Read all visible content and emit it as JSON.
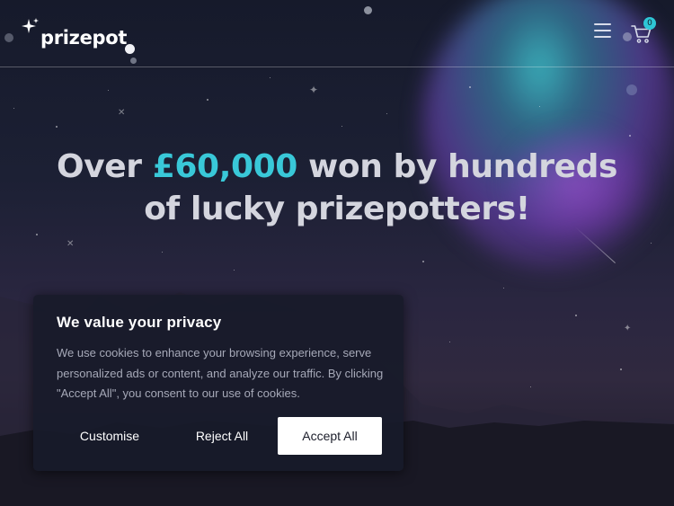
{
  "header": {
    "logo_text": "prizepot",
    "cart_count": "0",
    "menu_icon": "hamburger-menu-icon",
    "cart_icon": "shopping-cart-icon"
  },
  "hero": {
    "line1_before": "Over ",
    "line1_accent": "£60,000",
    "line1_after": " won by hundreds",
    "line2": "of lucky prizepotters!"
  },
  "cookie_banner": {
    "title": "We value your privacy",
    "body": "We use cookies to enhance your browsing experience, serve personalized ads or content, and analyze our traffic. By clicking \"Accept All\", you consent to our use of cookies.",
    "customise_label": "Customise",
    "reject_label": "Reject All",
    "accept_label": "Accept All"
  },
  "colors": {
    "accent": "#39c8d8",
    "background": "#1c2034",
    "banner_background": "#181b2a",
    "accept_button_background": "#ffffff"
  }
}
